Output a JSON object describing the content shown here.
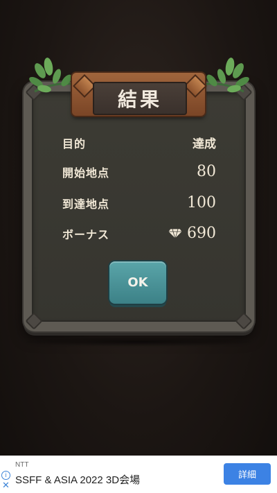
{
  "dialog": {
    "title": "結果",
    "rows": [
      {
        "label": "目的",
        "value": "達成"
      },
      {
        "label": "開始地点",
        "value": "80"
      },
      {
        "label": "到達地点",
        "value": "100"
      },
      {
        "label": "ボーナス",
        "value": "690",
        "icon": "diamond-icon"
      }
    ],
    "ok_label": "OK"
  },
  "ad": {
    "sponsor": "NTT",
    "title": "SSFF & ASIA 2022 3D会場",
    "button_label": "詳細",
    "info_icon": "info-icon",
    "close_icon": "close-icon"
  },
  "colors": {
    "background": "#1c1613",
    "panel": "#5e5a53",
    "panel_inner": "#3a3933",
    "title_plate": "#8c522d",
    "ok_button": "#4a9499",
    "ad_button": "#3c82e4"
  }
}
